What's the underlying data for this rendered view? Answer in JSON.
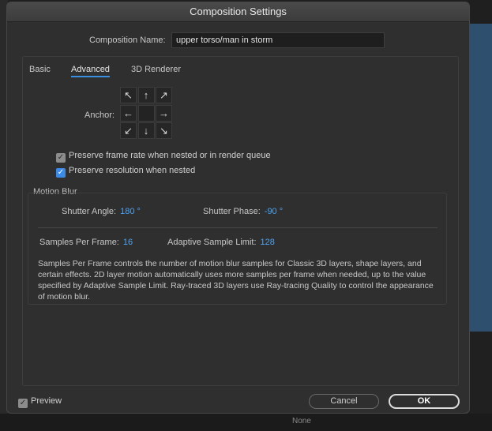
{
  "window": {
    "title": "Composition Settings"
  },
  "composition": {
    "name_label": "Composition Name:",
    "name_value": "upper torso/man in storm"
  },
  "tabs": [
    {
      "label": "Basic",
      "active": false
    },
    {
      "label": "Advanced",
      "active": true
    },
    {
      "label": "3D Renderer",
      "active": false
    }
  ],
  "anchor": {
    "label": "Anchor:",
    "arrows": [
      "↖",
      "↑",
      "↗",
      "←",
      "",
      "→",
      "↙",
      "↓",
      "↘"
    ]
  },
  "options": {
    "preserve_frame_rate": {
      "label": "Preserve frame rate when nested or in render queue",
      "checked": true
    },
    "preserve_resolution": {
      "label": "Preserve resolution when nested",
      "checked": true
    }
  },
  "motion_blur": {
    "title": "Motion Blur",
    "shutter_angle_label": "Shutter Angle:",
    "shutter_angle_value": "180 °",
    "shutter_phase_label": "Shutter Phase:",
    "shutter_phase_value": "-90 °",
    "samples_label": "Samples Per Frame:",
    "samples_value": "16",
    "adaptive_label": "Adaptive Sample Limit:",
    "adaptive_value": "128",
    "description": "Samples Per Frame controls the number of motion blur samples for Classic 3D layers, shape layers, and certain effects. 2D layer motion automatically uses more samples per frame when needed, up to the value specified by Adaptive Sample Limit. Ray-traced 3D layers use Ray-tracing Quality to control the appearance of motion blur."
  },
  "footer": {
    "preview_label": "Preview",
    "preview_checked": true,
    "cancel_label": "Cancel",
    "ok_label": "OK"
  },
  "background": {
    "bottom_text": "None"
  },
  "colors": {
    "accent": "#3b8ae6",
    "value_blue": "#4ea3f2"
  }
}
